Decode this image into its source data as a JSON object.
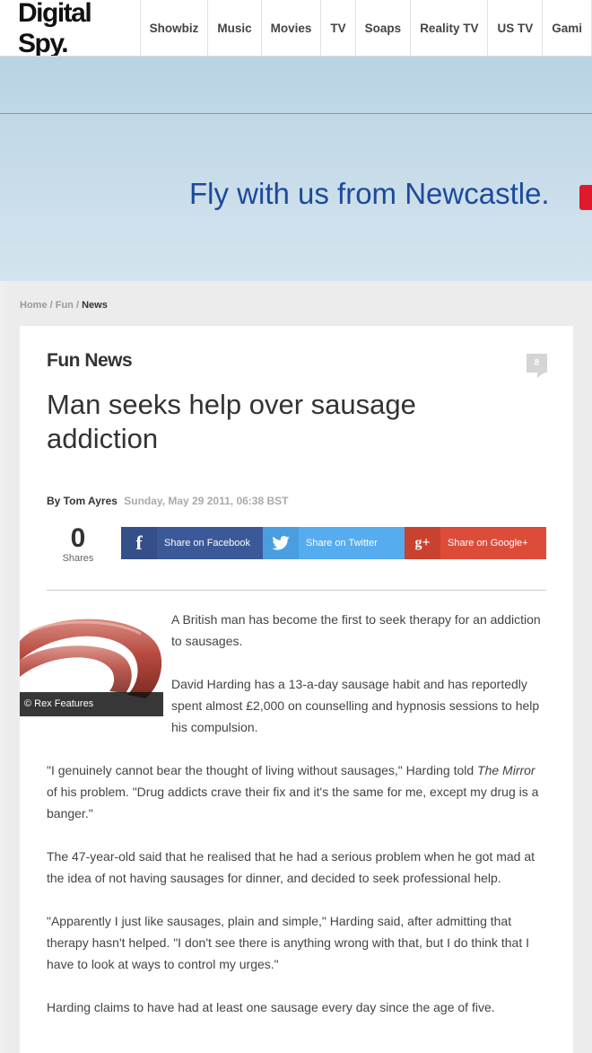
{
  "site": {
    "logo": "Digital Spy."
  },
  "nav": [
    "Showbiz",
    "Music",
    "Movies",
    "TV",
    "Soaps",
    "Reality TV",
    "US TV",
    "Gami"
  ],
  "banner": {
    "tagline": "Fly with us from Newcastle."
  },
  "breadcrumb": {
    "home": "Home",
    "sep1": " / ",
    "fun": "Fun",
    "sep2": " / ",
    "current": "News"
  },
  "article": {
    "section": "Fun News",
    "comment_count": "8",
    "headline": "Man seeks help over sausage addiction",
    "byline": {
      "author": "By Tom Ayres",
      "date": "Sunday, May 29 2011, 06:38 BST"
    },
    "shares": {
      "count": "0",
      "label": "Shares"
    },
    "share_buttons": {
      "facebook": {
        "icon": "f",
        "label": "Share on Facebook"
      },
      "twitter": {
        "icon": "twitter-bird",
        "label": "Share on Twitter"
      },
      "google": {
        "icon": "g+",
        "label": "Share on Google+"
      }
    },
    "image_credit": "© Rex Features",
    "paragraphs": {
      "p1": "A British man has become the first to seek therapy for an addiction to sausages.",
      "p2": "David Harding has a 13-a-day sausage habit and has reportedly spent almost £2,000 on counselling and hypnosis sessions to help his compulsion.",
      "p3_a": "\"I genuinely cannot bear the thought of living without sausages,\" Harding told ",
      "p3_em": "The Mirror",
      "p3_b": " of his problem. \"Drug addicts crave their fix and it's the same for me, except my drug is a banger.\"",
      "p4": "The 47-year-old said that he realised that he had a serious problem when he got mad at the idea of not having sausages for dinner, and decided to seek professional help.",
      "p5": "\"Apparently I just like sausages, plain and simple,\" Harding said, after admitting that therapy hasn't helped. \"I don't see there is anything wrong with that, but I do think that I have to look at ways to control my urges.\"",
      "p6": "Harding claims to have had at least one sausage every day since the age of five."
    }
  },
  "colors": {
    "facebook": "#3b5998",
    "twitter": "#55acee",
    "google": "#dd4b39",
    "banner_text": "#1c4a9a"
  }
}
